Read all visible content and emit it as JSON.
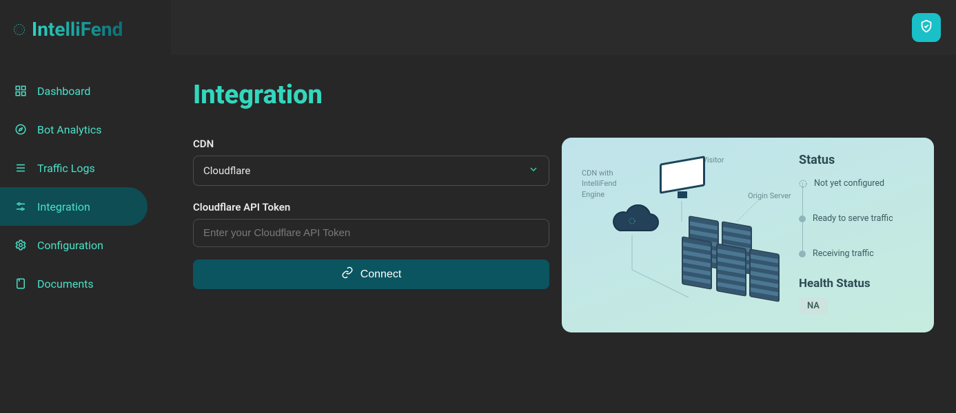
{
  "brand": "IntelliFend",
  "sidebar": {
    "items": [
      {
        "label": "Dashboard"
      },
      {
        "label": "Bot Analytics"
      },
      {
        "label": "Traffic Logs"
      },
      {
        "label": "Integration"
      },
      {
        "label": "Configuration"
      },
      {
        "label": "Documents"
      }
    ]
  },
  "page": {
    "title": "Integration"
  },
  "form": {
    "cdn_label": "CDN",
    "cdn_value": "Cloudflare",
    "token_label": "Cloudflare API Token",
    "token_placeholder": "Enter your Cloudflare API Token",
    "connect_label": "Connect"
  },
  "diagram": {
    "visitor": "Visitor",
    "cdn_with_engine": "CDN with IntelliFend Engine",
    "origin": "Origin Server"
  },
  "status": {
    "title": "Status",
    "items": [
      {
        "label": "Not yet configured"
      },
      {
        "label": "Ready to serve traffic"
      },
      {
        "label": "Receiving traffic"
      }
    ],
    "health_title": "Health Status",
    "health_value": "NA"
  }
}
